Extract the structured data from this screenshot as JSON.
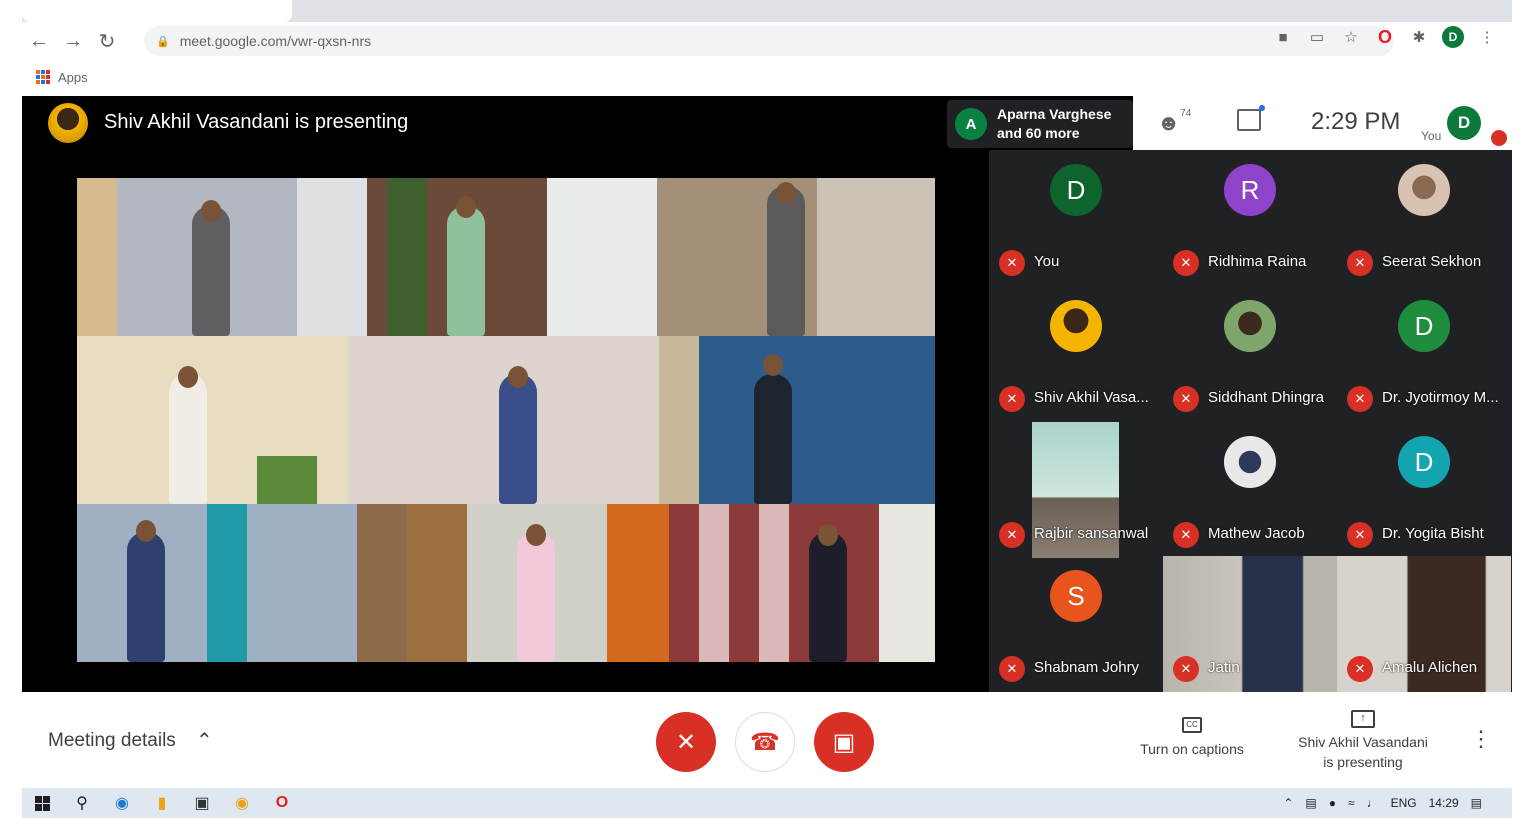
{
  "browser": {
    "url": "meet.google.com/vwr-qxsn-nrs",
    "bookmarks_apps": "Apps",
    "profile_initial": "D"
  },
  "meet": {
    "presenting_title": "Shiv Akhil Vasandani is presenting",
    "participants_chip": {
      "initial": "A",
      "line1": "Aparna Varghese",
      "line2": "and 60 more"
    },
    "participant_count": "74",
    "time": "2:29 PM",
    "you_label": "You",
    "self_initial": "D"
  },
  "participants": [
    {
      "name": "You",
      "initial": "D",
      "color": "#0d652d",
      "kind": "letter"
    },
    {
      "name": "Ridhima Raina",
      "initial": "R",
      "color": "#8e44c9",
      "kind": "letter"
    },
    {
      "name": "Seerat Sekhon",
      "kind": "photo",
      "color": "#d9c2b0"
    },
    {
      "name": "Shiv Akhil Vasa...",
      "kind": "photo",
      "color": "#f4b400"
    },
    {
      "name": "Siddhant Dhingra",
      "kind": "photo",
      "color": "#7fa66a"
    },
    {
      "name": "Dr. Jyotirmoy M...",
      "initial": "D",
      "color": "#1e8e3e",
      "kind": "letter"
    },
    {
      "name": "Rajbir sansanwal",
      "kind": "video",
      "color": "#a9d4cc"
    },
    {
      "name": "Mathew Jacob",
      "kind": "photo",
      "color": "#e8e8e8"
    },
    {
      "name": "Dr. Yogita Bisht",
      "initial": "D",
      "color": "#12a4af",
      "kind": "letter"
    },
    {
      "name": "Shabnam Johry",
      "initial": "S",
      "color": "#e8541e",
      "kind": "letter"
    },
    {
      "name": "Jatin",
      "kind": "video",
      "color": "#b9b4ac"
    },
    {
      "name": "Amalu Alichen",
      "kind": "video",
      "color": "#d7d2cb"
    }
  ],
  "controls": {
    "meeting_details": "Meeting details",
    "captions": "Turn on captions",
    "captions_icon": "CC",
    "presenting_line1": "Shiv Akhil Vasandani",
    "presenting_line2": "is presenting"
  },
  "taskbar": {
    "language": "ENG",
    "time": "14:29"
  },
  "colors": {
    "accent_red": "#d93025",
    "meet_dark": "#202124",
    "chrome_grey": "#5f6368"
  }
}
